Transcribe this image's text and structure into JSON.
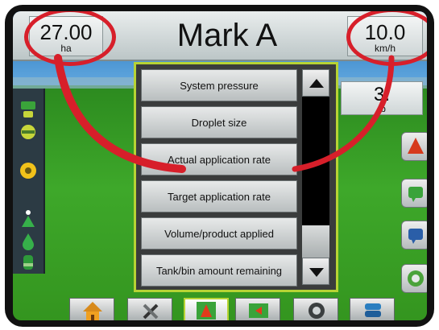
{
  "topbar": {
    "area": {
      "value": "27.00",
      "unit": "ha"
    },
    "title": "Mark A",
    "speed": {
      "value": "10.0",
      "unit": "km/h"
    }
  },
  "right_box": {
    "value": "3.",
    "unit": "(b"
  },
  "menu": {
    "items": [
      {
        "label": "System pressure"
      },
      {
        "label": "Droplet size"
      },
      {
        "label": "Actual application rate"
      },
      {
        "label": "Target application rate"
      },
      {
        "label": "Volume/product applied"
      },
      {
        "label": "Tank/bin amount remaining"
      }
    ]
  },
  "bottom_tabs": [
    {
      "icon": "home-icon"
    },
    {
      "icon": "tools-icon"
    },
    {
      "icon": "guidance-icon"
    },
    {
      "icon": "map-icon"
    },
    {
      "icon": "camera-icon"
    },
    {
      "icon": "data-icon"
    }
  ],
  "colors": {
    "highlight": "#b7d334",
    "annotation": "#d71f2a"
  }
}
